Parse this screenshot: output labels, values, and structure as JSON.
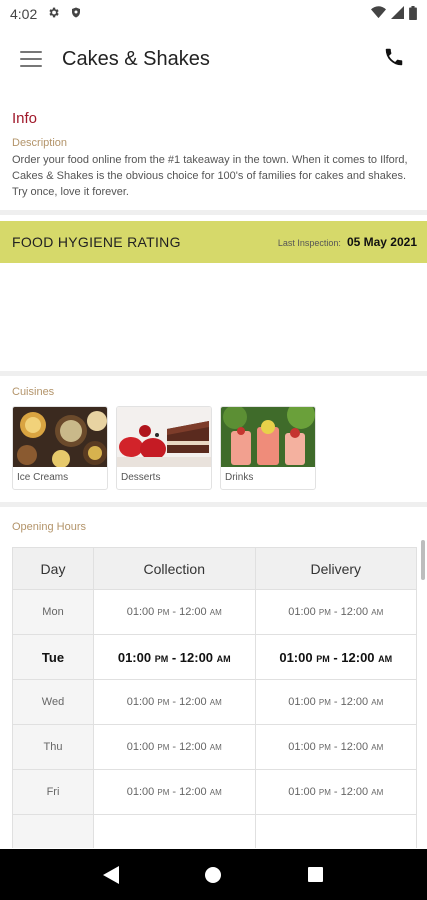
{
  "status_bar": {
    "time": "4:02",
    "icons": [
      "gear-icon",
      "shield-icon",
      "wifi-icon",
      "signal-icon",
      "battery-icon"
    ]
  },
  "app_bar": {
    "title": "Cakes & Shakes",
    "menu_icon": "hamburger-icon",
    "action_icon": "phone-icon"
  },
  "info": {
    "title": "Info",
    "description_label": "Description",
    "description": "Order your food online from the #1 takeaway in the town. When it comes to Ilford, Cakes & Shakes is the obvious choice for 100's of families for cakes and shakes. Try once, love it forever."
  },
  "hygiene": {
    "title": "FOOD HYGIENE RATING",
    "last_inspection_label": "Last Inspection:",
    "last_inspection_date": "05 May 2021",
    "color": "#d6d96a"
  },
  "cuisines": {
    "label": "Cuisines",
    "items": [
      {
        "name": "Ice Creams"
      },
      {
        "name": "Desserts"
      },
      {
        "name": "Drinks"
      }
    ]
  },
  "opening_hours": {
    "label": "Opening Hours",
    "headers": [
      "Day",
      "Collection",
      "Delivery"
    ],
    "rows": [
      {
        "day": "Mon",
        "c_from": "01:00",
        "c_from_ampm": "PM",
        "c_sep": " - ",
        "c_to": "12:00",
        "c_to_ampm": "AM",
        "d_from": "01:00",
        "d_from_ampm": "PM",
        "d_to": "12:00",
        "d_to_ampm": "AM"
      },
      {
        "day": "Tue",
        "c_from": "01:00",
        "c_from_ampm": "PM",
        "c_sep": " - ",
        "c_to": "12:00",
        "c_to_ampm": "AM",
        "d_from": "01:00",
        "d_from_ampm": "PM",
        "d_to": "12:00",
        "d_to_ampm": "AM"
      },
      {
        "day": "Wed",
        "c_from": "01:00",
        "c_from_ampm": "PM",
        "c_sep": " - ",
        "c_to": "12:00",
        "c_to_ampm": "AM",
        "d_from": "01:00",
        "d_from_ampm": "PM",
        "d_to": "12:00",
        "d_to_ampm": "AM"
      },
      {
        "day": "Thu",
        "c_from": "01:00",
        "c_from_ampm": "PM",
        "c_sep": " - ",
        "c_to": "12:00",
        "c_to_ampm": "AM",
        "d_from": "01:00",
        "d_from_ampm": "PM",
        "d_to": "12:00",
        "d_to_ampm": "AM"
      },
      {
        "day": "Fri",
        "c_from": "01:00",
        "c_from_ampm": "PM",
        "c_sep": " - ",
        "c_to": "12:00",
        "c_to_ampm": "AM",
        "d_from": "01:00",
        "d_from_ampm": "PM",
        "d_to": "12:00",
        "d_to_ampm": "AM"
      },
      {
        "day": "",
        "c_from": "",
        "c_from_ampm": "",
        "c_sep": "",
        "c_to": "",
        "c_to_ampm": "",
        "d_from": "",
        "d_from_ampm": "",
        "d_to": "",
        "d_to_ampm": ""
      }
    ],
    "today": "Tue"
  },
  "nav_bar": {
    "icons": [
      "back-icon",
      "home-icon",
      "recents-icon"
    ]
  },
  "colors": {
    "accent": "#a0182a",
    "label": "#b3946a"
  }
}
